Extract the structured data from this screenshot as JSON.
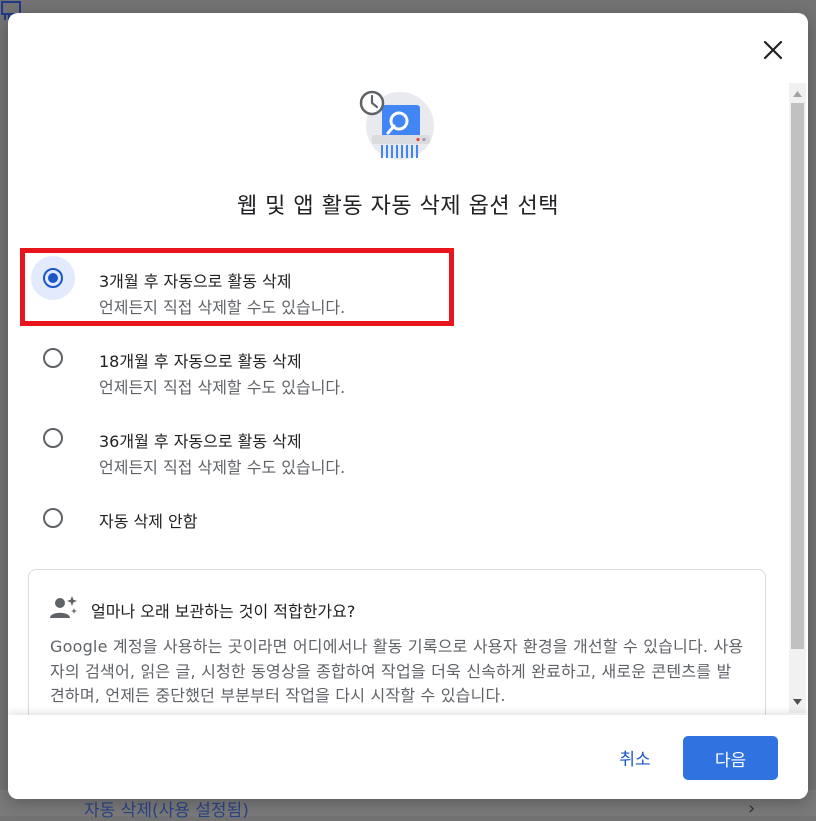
{
  "background_page": {
    "item_label": "자동 삭제(사용 설정됨)",
    "item_icon": "auto-delete-icon"
  },
  "dialog": {
    "close_icon": "close-icon",
    "hero_icon": "shredder-clock-icon",
    "title": "웹 및 앱 활동 자동 삭제 옵션 선택",
    "options": [
      {
        "label": "3개월 후 자동으로 활동 삭제",
        "sub": "언제든지 직접 삭제할 수도 있습니다.",
        "selected": true
      },
      {
        "label": "18개월 후 자동으로 활동 삭제",
        "sub": "언제든지 직접 삭제할 수도 있습니다.",
        "selected": false
      },
      {
        "label": "36개월 후 자동으로 활동 삭제",
        "sub": "언제든지 직접 삭제할 수도 있습니다.",
        "selected": false
      },
      {
        "label": "자동 삭제 안함",
        "sub": "",
        "selected": false
      }
    ],
    "info": {
      "icon": "person-sparkle-icon",
      "title": "얼마나 오래 보관하는 것이 적합한가요?",
      "body": "Google 계정을 사용하는 곳이라면 어디에서나 활동 기록으로 사용자 환경을 개선할 수 있습니다. 사용자의 검색어, 읽은 글, 시청한 동영상을 종합하여 작업을 더욱 신속하게 완료하고, 새로운 콘텐츠를 발견하며, 언제든 중단했던 부분부터 작업을 다시 시작할 수 있습니다."
    },
    "footer": {
      "cancel_label": "취소",
      "next_label": "다음"
    }
  },
  "colors": {
    "accent": "#1a56c8",
    "primary_button": "#2f72e0",
    "highlight_box": "#e8151f"
  }
}
